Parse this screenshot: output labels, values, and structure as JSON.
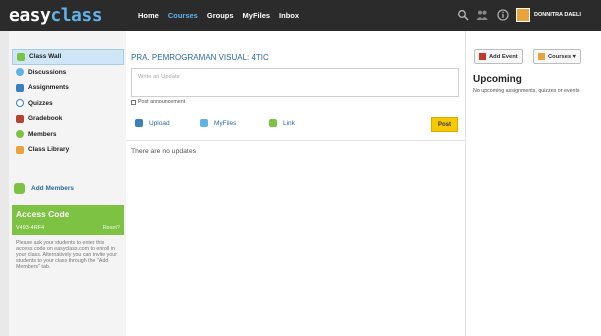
{
  "logo": {
    "part1": "easy",
    "part2": "class"
  },
  "nav": [
    {
      "label": "Home",
      "active": false
    },
    {
      "label": "Courses",
      "active": true
    },
    {
      "label": "Groups",
      "active": false
    },
    {
      "label": "MyFiles",
      "active": false
    },
    {
      "label": "Inbox",
      "active": false
    }
  ],
  "user": {
    "name": "DONNITRA DAELI"
  },
  "sidebar": {
    "items": [
      {
        "label": "Class Wall",
        "icon": "wall-icon",
        "color": "#7dc242",
        "active": true
      },
      {
        "label": "Discussions",
        "icon": "discussions-icon",
        "color": "#5fb3e6"
      },
      {
        "label": "Assignments",
        "icon": "assignments-icon",
        "color": "#3a7fc1"
      },
      {
        "label": "Quizzes",
        "icon": "quizzes-icon",
        "color": "#3a7fc1"
      },
      {
        "label": "Gradebook",
        "icon": "gradebook-icon",
        "color": "#b5432f"
      },
      {
        "label": "Members",
        "icon": "members-icon",
        "color": "#7dc242"
      },
      {
        "label": "Class Library",
        "icon": "library-icon",
        "color": "#e8a33a"
      }
    ],
    "add_members": "Add Members"
  },
  "access_code": {
    "title": "Access Code",
    "value": "V493-4RF4",
    "reset": "Reset?",
    "note": "Please ask your students to enter this access code on easyclass.com to enroll in your class. Alternatively you can invite your students to your class through the \"Add Members\" tab."
  },
  "main": {
    "class_name": "PRA. PEMROGRAMAN VISUAL: 4TIC",
    "update_placeholder": "Write an Update",
    "post_announcement": "Post announcement",
    "actions": {
      "upload": "Upload",
      "myfiles": "MyFiles",
      "link": "Link"
    },
    "post_button": "Post",
    "empty": "There are no updates"
  },
  "right": {
    "add_event": "Add Event",
    "courses": "Courses ▾",
    "upcoming_title": "Upcoming",
    "upcoming_text": "No upcoming assignments, quizzes or events"
  },
  "colors": {
    "topbar": "#2b2b2b",
    "accent": "#5fb3e6",
    "green": "#7dc242",
    "post": "#f6c800"
  }
}
